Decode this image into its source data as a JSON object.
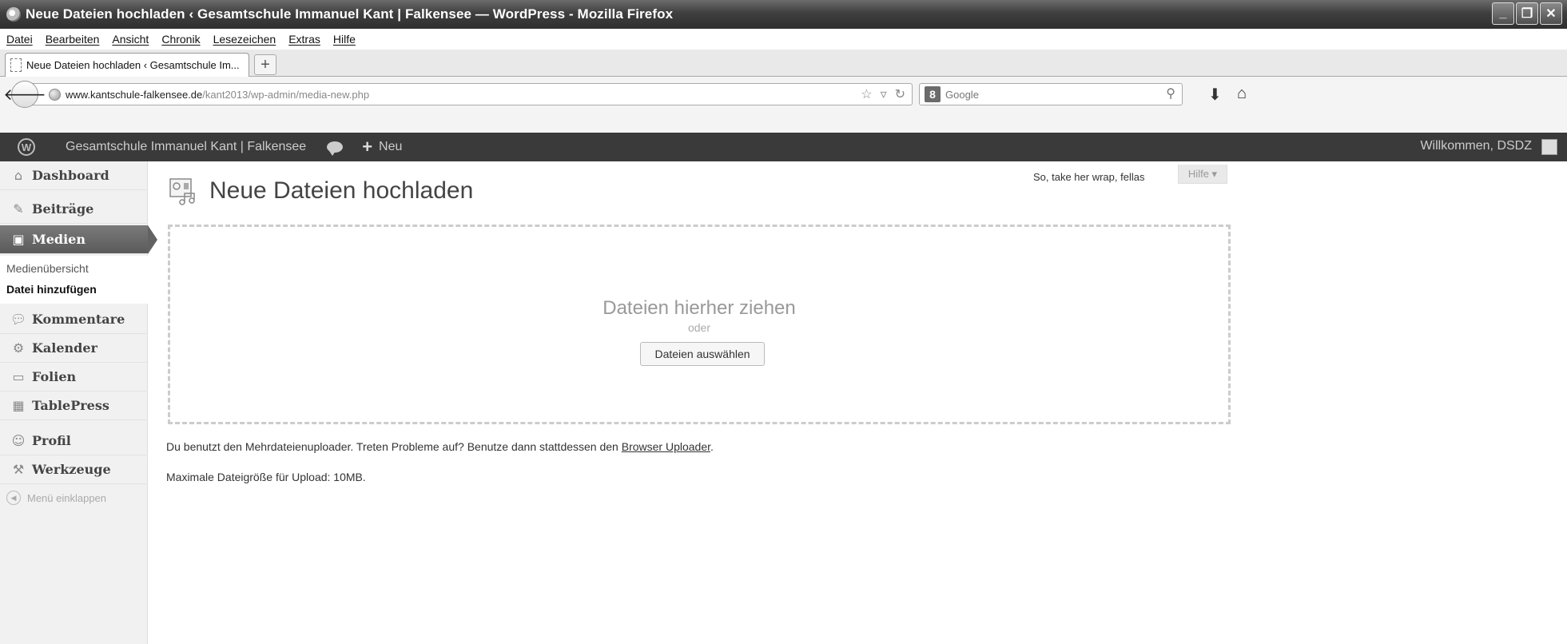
{
  "browser": {
    "window_title": "Neue Dateien hochladen ‹ Gesamtschule Immanuel Kant | Falkensee — WordPress - Mozilla Firefox",
    "menu": [
      "Datei",
      "Bearbeiten",
      "Ansicht",
      "Chronik",
      "Lesezeichen",
      "Extras",
      "Hilfe"
    ],
    "tab_title": "Neue Dateien hochladen ‹ Gesamtschule Im...",
    "url_domain": "www.kantschule-falkensee.de",
    "url_path": "/kant2013/wp-admin/media-new.php",
    "search_engine": "Google",
    "window_buttons": [
      "minimize",
      "maximize",
      "close"
    ]
  },
  "adminbar": {
    "site_name": "Gesamtschule Immanuel Kant | Falkensee",
    "new_label": "Neu",
    "welcome": "Willkommen, DSDZ"
  },
  "sidebar": {
    "items": [
      {
        "label": "Dashboard",
        "icon": "home-icon"
      },
      {
        "label": "Beiträge",
        "icon": "pushpin-icon"
      },
      {
        "label": "Medien",
        "icon": "media-icon"
      },
      {
        "label": "Kommentare",
        "icon": "comment-icon"
      },
      {
        "label": "Kalender",
        "icon": "calendar-icon"
      },
      {
        "label": "Folien",
        "icon": "slides-icon"
      },
      {
        "label": "TablePress",
        "icon": "table-icon"
      },
      {
        "label": "Profil",
        "icon": "users-icon"
      },
      {
        "label": "Werkzeuge",
        "icon": "tools-icon"
      }
    ],
    "submenu": [
      "Medienübersicht",
      "Datei hinzufügen"
    ],
    "collapse_label": "Menü einklappen"
  },
  "main": {
    "tagline": "So, take her wrap, fellas",
    "help_label": "Hilfe ▾",
    "page_title": "Neue Dateien hochladen",
    "drop_title": "Dateien hierher ziehen",
    "drop_or": "oder",
    "select_button": "Dateien auswählen",
    "info_text": "Du benutzt den Mehrdateienuploader. Treten Probleme auf? Benutze dann stattdessen den ",
    "info_link": "Browser Uploader",
    "info_end": ".",
    "max_size": "Maximale Dateigröße für Upload: 10MB."
  },
  "colors": {
    "adminbar": "#3a3a3a",
    "titlebar": "#3f3f3f",
    "active_menu": "#626262"
  }
}
